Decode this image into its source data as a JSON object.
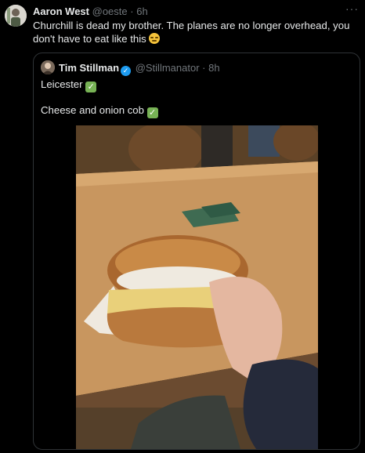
{
  "tweet": {
    "author_name": "Aaron West",
    "author_handle": "@oeste",
    "separator": "·",
    "time": "6h",
    "more_icon": "more-options-icon",
    "text": "Churchill is dead my brother. The planes are no longer overhead, you don't have to eat like this",
    "emoji": "pensive-face-icon"
  },
  "quote": {
    "author_name": "Tim Stillman",
    "author_handle": "@Stillmanator",
    "separator": "·",
    "time": "8h",
    "verified_icon": "verified-badge-icon",
    "line1": "Leicester",
    "line2": "Cheese and onion cob",
    "check_icon": "check-mark-button-icon"
  },
  "colors": {
    "background": "#000000",
    "text": "#e7e9ea",
    "muted": "#71767b",
    "border": "#2f3336",
    "verified": "#1d9bf0"
  }
}
